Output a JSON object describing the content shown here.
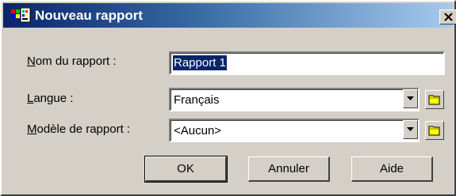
{
  "window": {
    "title": "Nouveau rapport",
    "close_glyph": "×"
  },
  "form": {
    "name": {
      "label_mnemonic": "N",
      "label_rest": "om du rapport :",
      "value": "Rapport 1"
    },
    "language": {
      "label_mnemonic": "L",
      "label_rest": "angue :",
      "value": "Français"
    },
    "template": {
      "label_mnemonic": "M",
      "label_rest": "odèle de rapport :",
      "value": "<Aucun>"
    }
  },
  "buttons": {
    "ok": "OK",
    "cancel": "Annuler",
    "help": "Aide"
  },
  "icons": {
    "app": "app-icon",
    "close": "close-icon",
    "dropdown": "chevron-down-icon",
    "folder": "folder-icon"
  },
  "colors": {
    "titlebar_start": "#0a246a",
    "titlebar_end": "#a6caf0",
    "face": "#d4d0c8",
    "selection": "#0a246a",
    "folder": "#ffff00"
  }
}
